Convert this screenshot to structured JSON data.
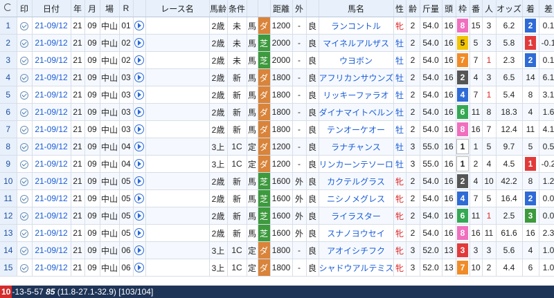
{
  "columns": [
    "",
    "印",
    "日付",
    "年",
    "月",
    "場",
    "R",
    "",
    "レース名",
    "馬齢",
    "条件",
    "",
    "",
    "距離",
    "外",
    "",
    "馬名",
    "性",
    "齢",
    "斤量",
    "頭",
    "枠",
    "番",
    "人",
    "オッズ",
    "着",
    "差"
  ],
  "rows": [
    {
      "n": "1",
      "date": "21-09/12",
      "y": "21",
      "m": "09",
      "place": "中山",
      "r": "01",
      "age": "2歳",
      "cond": "未",
      "kind": "馬",
      "surf": "ダ",
      "dist": "1200",
      "out": "-",
      "track": "良",
      "horse": "ランコントル",
      "sex": "牝",
      "hage": "2",
      "weight": "54.0",
      "heads": "16",
      "waku": "8",
      "num": "15",
      "pop": "3",
      "odds": "6.2",
      "rank": "2",
      "diff": "0.1"
    },
    {
      "n": "2",
      "date": "21-09/12",
      "y": "21",
      "m": "09",
      "place": "中山",
      "r": "02",
      "age": "2歳",
      "cond": "未",
      "kind": "馬",
      "surf": "芝",
      "dist": "2000",
      "out": "-",
      "track": "良",
      "horse": "マイネルアルザス",
      "sex": "牡",
      "hage": "2",
      "weight": "54.0",
      "heads": "16",
      "waku": "5",
      "num": "5",
      "pop": "3",
      "odds": "5.8",
      "rank": "1",
      "diff": "-0.1"
    },
    {
      "n": "3",
      "date": "21-09/12",
      "y": "21",
      "m": "09",
      "place": "中山",
      "r": "02",
      "age": "2歳",
      "cond": "未",
      "kind": "馬",
      "surf": "芝",
      "dist": "2000",
      "out": "-",
      "track": "良",
      "horse": "ウヨボン",
      "sex": "牡",
      "hage": "2",
      "weight": "54.0",
      "heads": "16",
      "waku": "7",
      "num": "7",
      "pop": "1",
      "odds": "2.3",
      "rank": "2",
      "diff": "0.1"
    },
    {
      "n": "4",
      "date": "21-09/12",
      "y": "21",
      "m": "09",
      "place": "中山",
      "r": "03",
      "age": "2歳",
      "cond": "新",
      "kind": "馬",
      "surf": "ダ",
      "dist": "1800",
      "out": "-",
      "track": "良",
      "horse": "アフリカンサウンズ",
      "sex": "牡",
      "hage": "2",
      "weight": "54.0",
      "heads": "16",
      "waku": "2",
      "num": "4",
      "pop": "3",
      "odds": "6.5",
      "rank": "14",
      "diff": "6.1"
    },
    {
      "n": "5",
      "date": "21-09/12",
      "y": "21",
      "m": "09",
      "place": "中山",
      "r": "03",
      "age": "2歳",
      "cond": "新",
      "kind": "馬",
      "surf": "ダ",
      "dist": "1800",
      "out": "-",
      "track": "良",
      "horse": "リッキーファラオ",
      "sex": "牡",
      "hage": "2",
      "weight": "54.0",
      "heads": "16",
      "waku": "4",
      "num": "7",
      "pop": "1",
      "odds": "5.4",
      "rank": "8",
      "diff": "3.1"
    },
    {
      "n": "6",
      "date": "21-09/12",
      "y": "21",
      "m": "09",
      "place": "中山",
      "r": "03",
      "age": "2歳",
      "cond": "新",
      "kind": "馬",
      "surf": "ダ",
      "dist": "1800",
      "out": "-",
      "track": "良",
      "horse": "ダイナマイトベルン",
      "sex": "牡",
      "hage": "2",
      "weight": "54.0",
      "heads": "16",
      "waku": "6",
      "num": "11",
      "pop": "8",
      "odds": "18.3",
      "rank": "4",
      "diff": "1.6"
    },
    {
      "n": "7",
      "date": "21-09/12",
      "y": "21",
      "m": "09",
      "place": "中山",
      "r": "03",
      "age": "2歳",
      "cond": "新",
      "kind": "馬",
      "surf": "ダ",
      "dist": "1800",
      "out": "-",
      "track": "良",
      "horse": "テンオーケオー",
      "sex": "牡",
      "hage": "2",
      "weight": "54.0",
      "heads": "16",
      "waku": "8",
      "num": "16",
      "pop": "7",
      "odds": "12.4",
      "rank": "11",
      "diff": "4.1"
    },
    {
      "n": "8",
      "date": "21-09/12",
      "y": "21",
      "m": "09",
      "place": "中山",
      "r": "04",
      "age": "3上",
      "cond": "1C",
      "kind": "定",
      "surf": "ダ",
      "dist": "1200",
      "out": "-",
      "track": "良",
      "horse": "ラナチャンス",
      "sex": "牡",
      "hage": "3",
      "weight": "55.0",
      "heads": "16",
      "waku": "1",
      "num": "1",
      "pop": "5",
      "odds": "9.7",
      "rank": "5",
      "diff": "0.5"
    },
    {
      "n": "9",
      "date": "21-09/12",
      "y": "21",
      "m": "09",
      "place": "中山",
      "r": "04",
      "age": "3上",
      "cond": "1C",
      "kind": "定",
      "surf": "ダ",
      "dist": "1200",
      "out": "-",
      "track": "良",
      "horse": "リンカーンテソーロ",
      "sex": "牡",
      "hage": "3",
      "weight": "55.0",
      "heads": "16",
      "waku": "1",
      "num": "2",
      "pop": "4",
      "odds": "4.5",
      "rank": "1",
      "diff": "-0.2"
    },
    {
      "n": "10",
      "date": "21-09/12",
      "y": "21",
      "m": "09",
      "place": "中山",
      "r": "05",
      "age": "2歳",
      "cond": "新",
      "kind": "馬",
      "surf": "芝",
      "dist": "1600",
      "out": "外",
      "track": "良",
      "horse": "カクテルグラス",
      "sex": "牝",
      "hage": "2",
      "weight": "54.0",
      "heads": "16",
      "waku": "2",
      "num": "4",
      "pop": "10",
      "odds": "42.2",
      "rank": "8",
      "diff": "1.2"
    },
    {
      "n": "11",
      "date": "21-09/12",
      "y": "21",
      "m": "09",
      "place": "中山",
      "r": "05",
      "age": "2歳",
      "cond": "新",
      "kind": "馬",
      "surf": "芝",
      "dist": "1600",
      "out": "外",
      "track": "良",
      "horse": "ニシノメグレス",
      "sex": "牝",
      "hage": "2",
      "weight": "54.0",
      "heads": "16",
      "waku": "4",
      "num": "7",
      "pop": "5",
      "odds": "16.4",
      "rank": "2",
      "diff": "0.0"
    },
    {
      "n": "12",
      "date": "21-09/12",
      "y": "21",
      "m": "09",
      "place": "中山",
      "r": "05",
      "age": "2歳",
      "cond": "新",
      "kind": "馬",
      "surf": "芝",
      "dist": "1600",
      "out": "外",
      "track": "良",
      "horse": "ライラスター",
      "sex": "牝",
      "hage": "2",
      "weight": "54.0",
      "heads": "16",
      "waku": "6",
      "num": "11",
      "pop": "1",
      "odds": "2.5",
      "rank": "3",
      "diff": "0.0"
    },
    {
      "n": "13",
      "date": "21-09/12",
      "y": "21",
      "m": "09",
      "place": "中山",
      "r": "05",
      "age": "2歳",
      "cond": "新",
      "kind": "馬",
      "surf": "芝",
      "dist": "1600",
      "out": "外",
      "track": "良",
      "horse": "スナノヨウセイ",
      "sex": "牝",
      "hage": "2",
      "weight": "54.0",
      "heads": "16",
      "waku": "8",
      "num": "16",
      "pop": "11",
      "odds": "61.6",
      "rank": "16",
      "diff": "2.3"
    },
    {
      "n": "14",
      "date": "21-09/12",
      "y": "21",
      "m": "09",
      "place": "中山",
      "r": "06",
      "age": "3上",
      "cond": "1C",
      "kind": "定",
      "surf": "ダ",
      "dist": "1800",
      "out": "-",
      "track": "良",
      "horse": "アオイシチフク",
      "sex": "牝",
      "hage": "3",
      "weight": "52.0",
      "heads": "13",
      "waku": "3",
      "num": "3",
      "pop": "3",
      "odds": "5.6",
      "rank": "4",
      "diff": "1.0"
    },
    {
      "n": "15",
      "date": "21-09/12",
      "y": "21",
      "m": "09",
      "place": "中山",
      "r": "06",
      "age": "3上",
      "cond": "1C",
      "kind": "定",
      "surf": "ダ",
      "dist": "1800",
      "out": "-",
      "track": "良",
      "horse": "シャドウアルテミス",
      "sex": "牝",
      "hage": "3",
      "weight": "52.0",
      "heads": "13",
      "waku": "7",
      "num": "10",
      "pop": "2",
      "odds": "4.4",
      "rank": "6",
      "diff": "1.0"
    }
  ],
  "status": {
    "badge": "10",
    "line": "-13-5-57 ",
    "bold": "85",
    "rest": " (11.8-27.1-32.9) [103/104]"
  }
}
